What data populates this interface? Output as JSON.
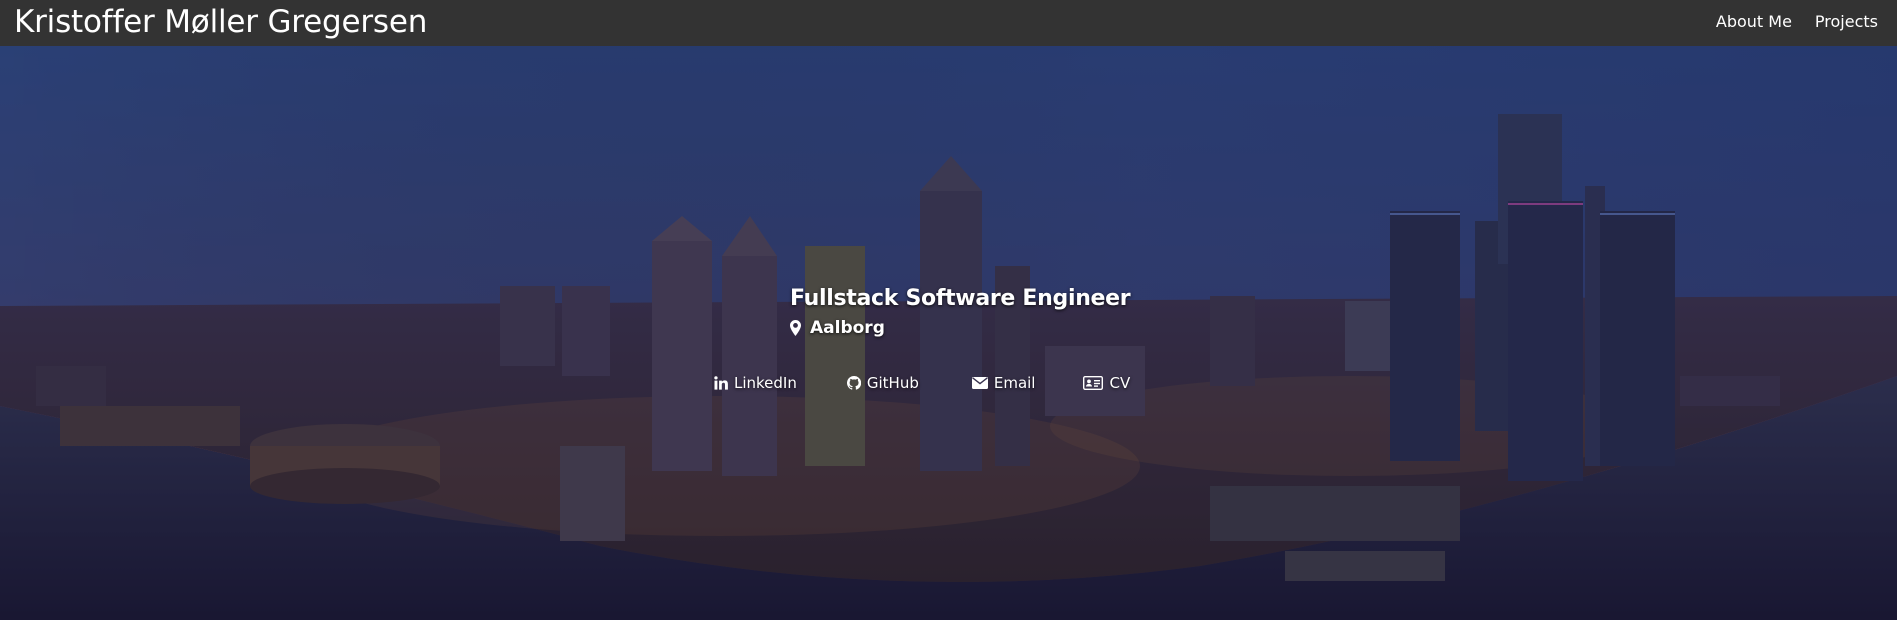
{
  "navbar": {
    "brand": "Kristoffer Møller Gregersen",
    "links": [
      "About Me",
      "Projects"
    ]
  },
  "hero": {
    "headline": "Fullstack Software Engineer",
    "location": "Aalborg",
    "links": [
      {
        "label": "LinkedIn",
        "icon": "linkedin-icon"
      },
      {
        "label": "GitHub",
        "icon": "github-icon"
      },
      {
        "label": "Email",
        "icon": "envelope-icon"
      },
      {
        "label": "CV",
        "icon": "id-card-icon"
      }
    ],
    "background": "city-skyline-night-photo"
  },
  "colors": {
    "navbar": "#333333",
    "text": "#ffffff",
    "sky_top": "#3a5a9c",
    "sky_horizon": "#c4604a",
    "water": "#243048"
  }
}
